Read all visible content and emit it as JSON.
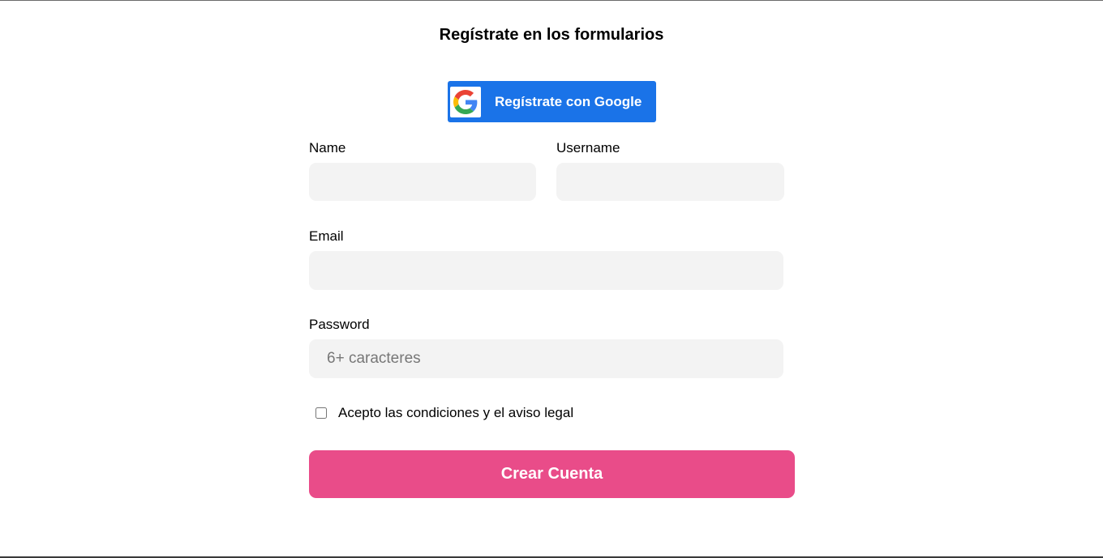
{
  "form": {
    "title": "Regístrate en los formularios",
    "google_button": {
      "label": "Regístrate con Google",
      "icon": "google-icon",
      "color": "#1a73e8"
    },
    "fields": {
      "name": {
        "label": "Name",
        "value": "",
        "placeholder": ""
      },
      "username": {
        "label": "Username",
        "value": "",
        "placeholder": ""
      },
      "email": {
        "label": "Email",
        "value": "",
        "placeholder": ""
      },
      "password": {
        "label": "Password",
        "value": "",
        "placeholder": "6+ caracteres"
      }
    },
    "terms": {
      "label": "Acepto las condiciones y el aviso legal",
      "checked": false
    },
    "submit": {
      "label": "Crear Cuenta",
      "color": "#e94c89"
    }
  }
}
